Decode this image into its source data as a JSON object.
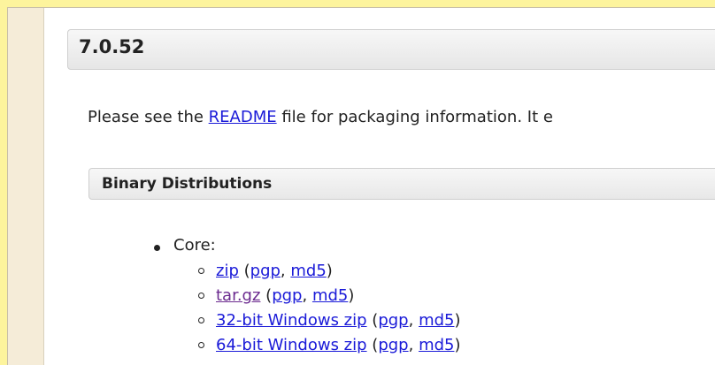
{
  "version": {
    "title": "7.0.52"
  },
  "intro": {
    "prefix": "Please see the ",
    "readme_link": "README",
    "suffix": " file for packaging information. It e"
  },
  "binary": {
    "title": "Binary Distributions",
    "core_label": "Core:",
    "items": [
      {
        "name": "zip",
        "pgp": "pgp",
        "md5": "md5",
        "visited": false
      },
      {
        "name": "tar.gz",
        "pgp": "pgp",
        "md5": "md5",
        "visited": true
      },
      {
        "name": "32-bit Windows zip",
        "pgp": "pgp",
        "md5": "md5",
        "visited": false
      },
      {
        "name": "64-bit Windows zip",
        "pgp": "pgp",
        "md5": "md5",
        "visited": false
      }
    ]
  },
  "colors": {
    "page_background": "#fdf49d",
    "link": "#1a1ad8",
    "visited_link": "#6b2a8f"
  }
}
